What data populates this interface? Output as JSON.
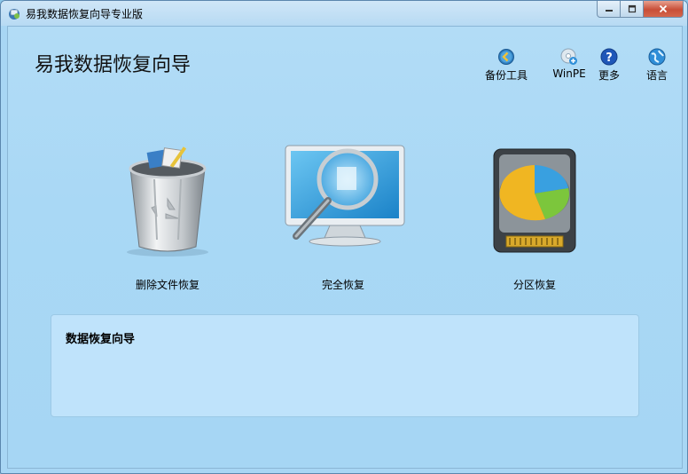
{
  "window": {
    "title": "易我数据恢复向导专业版",
    "minimize_icon": "minimize-icon",
    "maximize_icon": "maximize-icon",
    "close_icon": "close-icon"
  },
  "header": {
    "app_title": "易我数据恢复向导"
  },
  "toolbar": {
    "items": [
      {
        "label": "备份工具",
        "icon": "back-arrow-icon"
      },
      {
        "label": "WinPE",
        "icon": "winpe-disc-icon"
      },
      {
        "label": "更多",
        "icon": "help-icon"
      },
      {
        "label": "语言",
        "icon": "globe-icon"
      }
    ]
  },
  "features": [
    {
      "label": "删除文件恢复",
      "icon": "recycle-bin-icon"
    },
    {
      "label": "完全恢复",
      "icon": "monitor-magnifier-icon"
    },
    {
      "label": "分区恢复",
      "icon": "hard-drive-pie-icon"
    }
  ],
  "description": {
    "title": "数据恢复向导"
  },
  "colors": {
    "background": "#a8d6f4",
    "panel": "#bfe3fb",
    "close_button": "#c84f38"
  }
}
